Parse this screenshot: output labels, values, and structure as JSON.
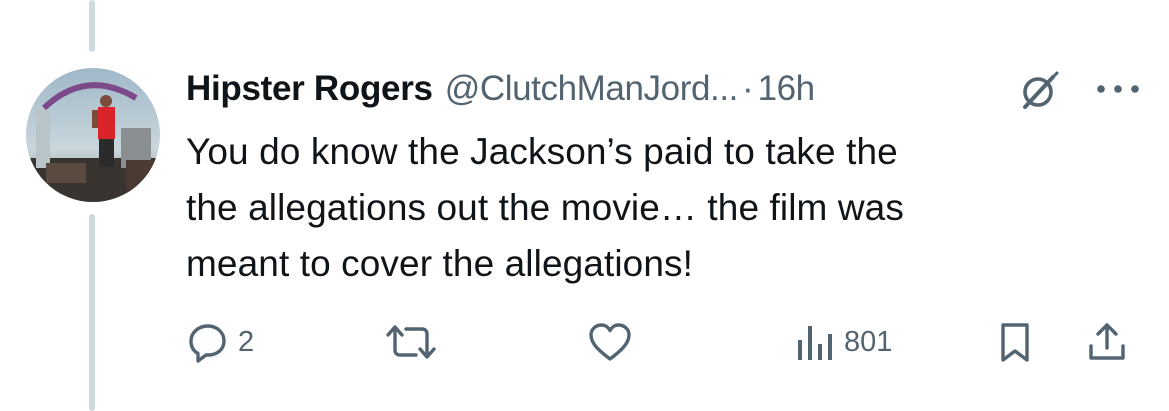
{
  "tweet": {
    "display_name": "Hipster Rogers",
    "handle": "@ClutchManJord...",
    "separator": "·",
    "timestamp": "16h",
    "text_lines": [
      "You do know the Jackson’s paid to take the",
      "the allegations out the movie… the film was",
      "meant to cover the allegations!"
    ]
  },
  "actions": {
    "reply_count": "2",
    "retweet_count": "",
    "like_count": "",
    "views_count": "801"
  },
  "icons": {
    "reply": "reply-icon",
    "retweet": "retweet-icon",
    "like": "heart-icon",
    "views": "views-icon",
    "bookmark": "bookmark-icon",
    "share": "share-icon",
    "grok": "grok-icon",
    "more": "more-icon"
  },
  "colors": {
    "text_primary": "#0f1419",
    "text_secondary": "#536471",
    "thread_line": "#cfd9de"
  }
}
